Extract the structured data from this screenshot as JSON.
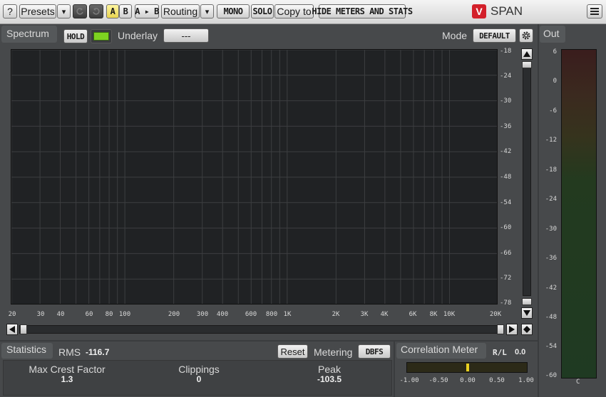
{
  "toolbar": {
    "help": "?",
    "presets": "Presets",
    "dropdown": "▾",
    "a": "A",
    "b": "B",
    "a_to_b": "A ▸ B",
    "routing": "Routing",
    "mono": "MONO",
    "solo": "SOLO",
    "copy_to": "Copy to",
    "hide_meters": "HIDE METERS AND STATS",
    "app_name": "SPAN",
    "logo_glyph": "V",
    "menu_icon": "menu-icon"
  },
  "spectrum": {
    "title": "Spectrum",
    "hold": "HOLD",
    "underlay_label": "Underlay",
    "underlay_value": "---",
    "mode_label": "Mode",
    "mode_value": "DEFAULT",
    "db_ticks": [
      "-18",
      "-24",
      "-30",
      "-36",
      "-42",
      "-48",
      "-54",
      "-60",
      "-66",
      "-72",
      "-78"
    ],
    "freq_ticks": [
      "20",
      "30",
      "40",
      "60",
      "80",
      "100",
      "200",
      "300",
      "400",
      "600",
      "800",
      "1K",
      "2K",
      "3K",
      "4K",
      "6K",
      "8K",
      "10K",
      "20K"
    ],
    "hold_indicator_color": "#7ed321"
  },
  "out": {
    "title": "Out",
    "ticks": [
      "6",
      "0",
      "-6",
      "-12",
      "-18",
      "-24",
      "-30",
      "-36",
      "-42",
      "-48",
      "-54",
      "-60"
    ],
    "channel_label": "C"
  },
  "statistics": {
    "title": "Statistics",
    "rms_label": "RMS",
    "rms_value": "-116.7",
    "reset": "Reset",
    "metering_label": "Metering",
    "metering_value": "DBFS",
    "max_crest_label": "Max Crest Factor",
    "max_crest_value": "1.3",
    "clippings_label": "Clippings",
    "clippings_value": "0",
    "peak_label": "Peak",
    "peak_value": "-103.5"
  },
  "correlation": {
    "title": "Correlation Meter",
    "rl_label": "R/L",
    "rl_value": "0.0",
    "ticks": [
      "-1.00",
      "-0.50",
      "0.00",
      "0.50",
      "1.00"
    ],
    "value": 0.0,
    "indicator_color": "#e8d020"
  }
}
